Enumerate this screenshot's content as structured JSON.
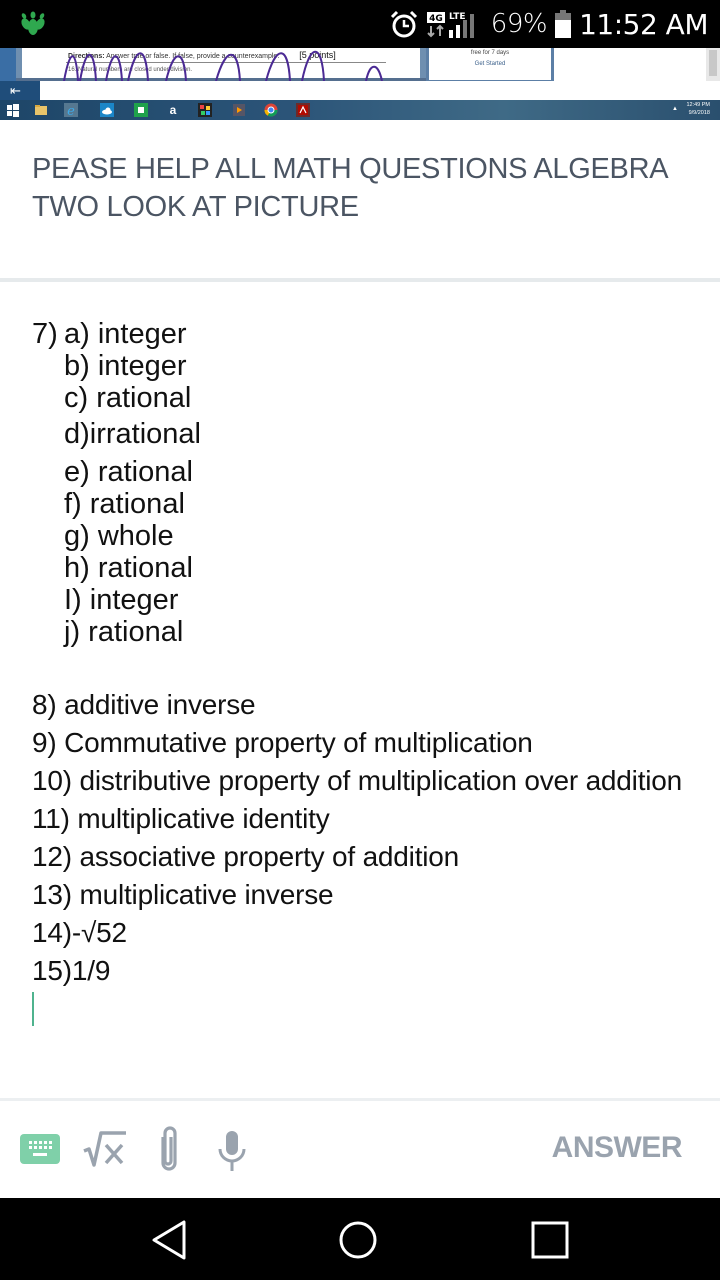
{
  "status_bar": {
    "app_icon": "app-notification-icon",
    "alarm_icon": "alarm-icon",
    "network_type": "4G",
    "network_label": "LTE",
    "battery_percent": "69%",
    "time": "11:52 AM"
  },
  "embedded_photo": {
    "directions_label": "Directions:",
    "directions_text": "Answer true or false. If false, provide a counterexample.",
    "points": "[5 points]",
    "item_16": "16. Natural numbers are closed under division.",
    "side_panel_text": "free for 7 days",
    "side_panel_link": "Get Started",
    "taskbar_time": "12:49 PM",
    "taskbar_date": "9/9/2018",
    "taskbar_icons": [
      "windows-start-icon",
      "file-explorer-icon",
      "internet-explorer-icon",
      "onedrive-icon",
      "store-icon",
      "amazon-icon",
      "games-icon",
      "media-player-icon",
      "chrome-icon",
      "acrobat-icon"
    ]
  },
  "question": {
    "text": "PEASE HELP ALL MATH QUESTIONS ALGEBRA TWO LOOK AT PICTURE"
  },
  "answer": {
    "q7_number": "7)",
    "q7_items": [
      "a) integer",
      "b) integer",
      "c) rational",
      "d)irrational",
      "e) rational",
      "f) rational",
      "g) whole",
      "h) rational",
      "I) integer",
      "j) rational"
    ],
    "lines": [
      "8) additive inverse",
      "9) Commutative property of multiplication",
      "10) distributive property of multiplication over addition",
      "11) multiplicative identity",
      "12) associative property of addition",
      "13) multiplicative inverse",
      "14)-√52",
      "15)1/9"
    ]
  },
  "toolbar": {
    "keyboard_icon": "keyboard-icon",
    "math_icon": "square-root-icon",
    "attach_icon": "paperclip-icon",
    "mic_icon": "microphone-icon",
    "answer_label": "ANSWER",
    "accent_color": "#7fd0a9",
    "muted_color": "#9aa3ae"
  },
  "navbar": {
    "back": "back-icon",
    "home": "home-icon",
    "recents": "recents-icon"
  }
}
